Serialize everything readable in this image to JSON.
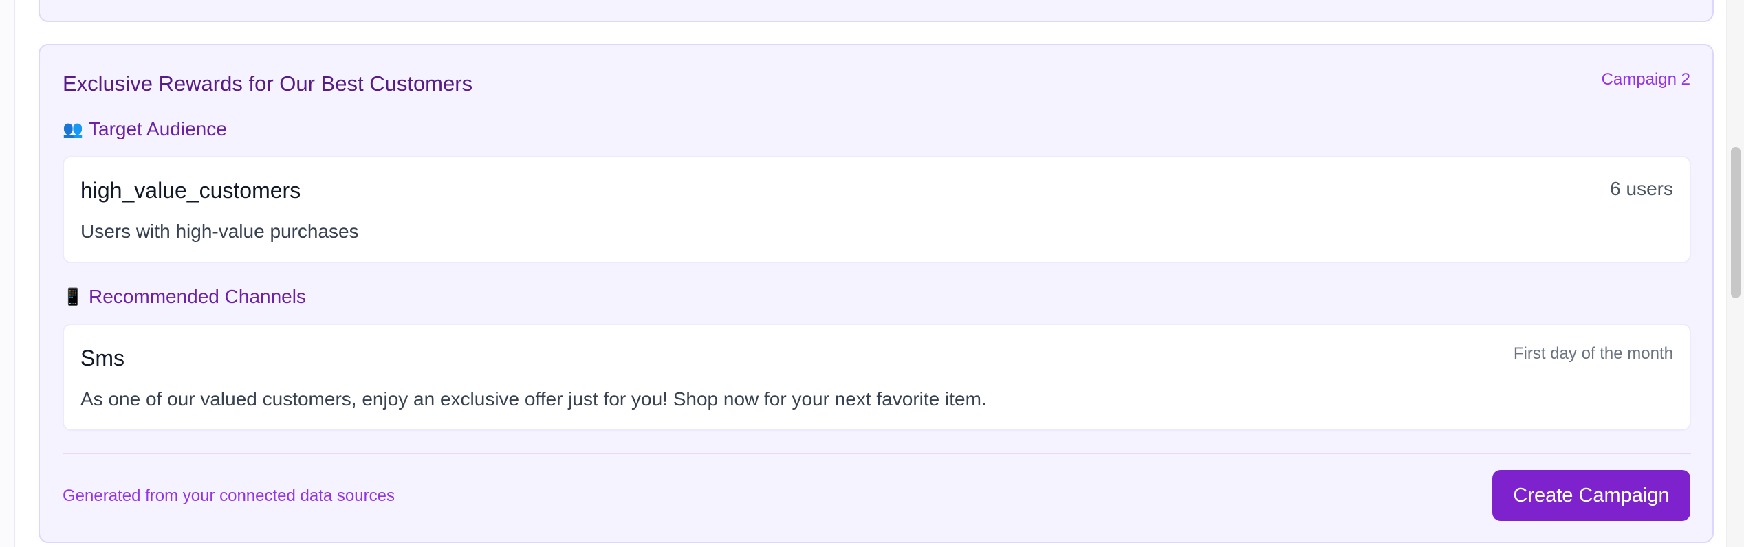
{
  "campaign": {
    "title": "Exclusive Rewards for Our Best Customers",
    "number_label": "Campaign 2",
    "audience": {
      "heading_icon": "👥",
      "heading": "Target Audience",
      "segment_name": "high_value_customers",
      "user_count": "6 users",
      "description": "Users with high-value purchases"
    },
    "channels": {
      "heading_icon": "📱",
      "heading": "Recommended Channels",
      "items": [
        {
          "name": "Sms",
          "timing": "First day of the month",
          "message": "As one of our valued customers, enjoy an exclusive offer just for you! Shop now for your next favorite item."
        }
      ]
    },
    "footer_note": "Generated from your connected data sources",
    "create_button_label": "Create Campaign"
  },
  "colors": {
    "card_background": "#f5f3ff",
    "card_border": "#ddd6fe",
    "title": "#581c87",
    "accent": "#7e22ce",
    "accent_text": "#9333ea"
  }
}
